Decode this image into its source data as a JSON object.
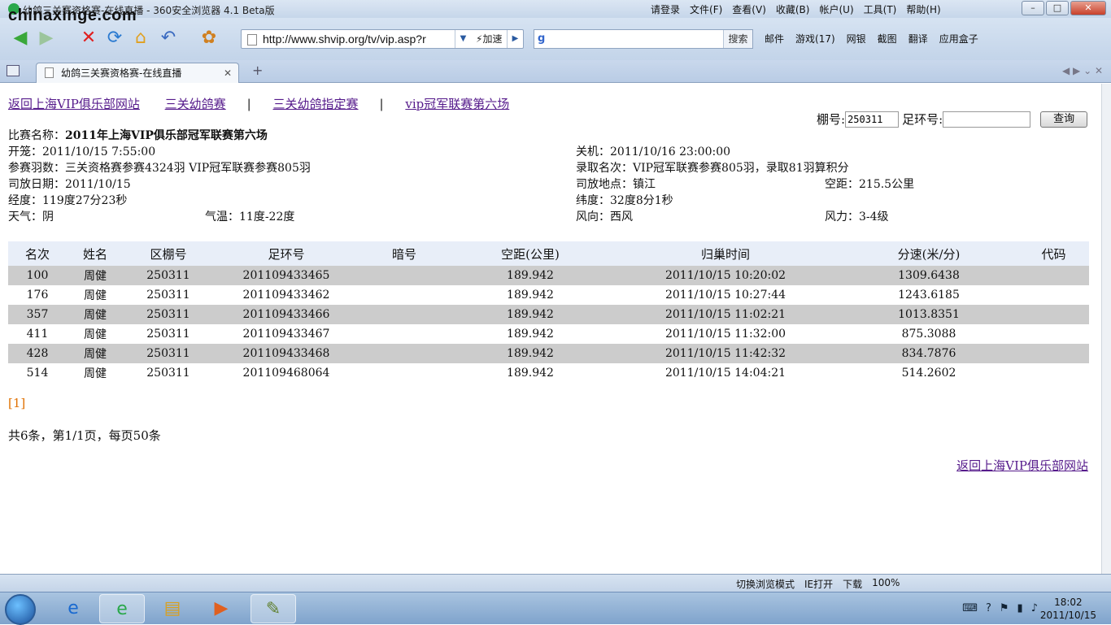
{
  "watermark": "chinaxinge.com",
  "window": {
    "title": "幼鸽三关赛资格赛-在线直播 - 360安全浏览器 4.1 Beta版",
    "menu": [
      "请登录",
      "文件(F)",
      "查看(V)",
      "收藏(B)",
      "帐户(U)",
      "工具(T)",
      "帮助(H)"
    ]
  },
  "toolbar": {
    "url": "http://www.shvip.org/tv/vip.asp?r",
    "speed_label": "加速",
    "search_button": "搜索",
    "tools": [
      "邮件",
      "游戏(17)",
      "网银",
      "截图",
      "翻译",
      "应用盒子"
    ]
  },
  "tab": {
    "title": "幼鸽三关赛资格赛-在线直播"
  },
  "page": {
    "links": [
      "返回上海VIP俱乐部网站",
      "三关幼鸽赛",
      "三关幼鸽指定赛",
      "vip冠军联赛第六场"
    ],
    "sep": "|",
    "query": {
      "shed_label": "棚号:",
      "shed_value": "250311",
      "ring_label": "足环号:",
      "ring_value": "",
      "button": "查询"
    },
    "info": {
      "race_label": "比赛名称：",
      "race_name": "2011年上海VIP俱乐部冠军联赛第六场",
      "open": "开笼：2011/10/15 7:55:00",
      "close": "关机：2011/10/16 23:00:00",
      "entries": "参赛羽数：三关资格赛参赛4324羽 VIP冠军联赛参赛805羽",
      "admitted": "录取名次：VIP冠军联赛参赛805羽，录取81羽算积分",
      "release_date": "司放日期：2011/10/15",
      "release_place": "司放地点：镇江",
      "distance": "空距：215.5公里",
      "longitude": "经度：119度27分23秒",
      "latitude": "纬度：32度8分1秒",
      "weather": "天气：阴",
      "temperature": "气温：11度-22度",
      "wind_dir": "风向：西风",
      "wind_force": "风力：3-4级"
    },
    "table": {
      "headers": [
        "名次",
        "姓名",
        "区棚号",
        "足环号",
        "暗号",
        "空距(公里)",
        "归巢时间",
        "分速(米/分)",
        "代码"
      ],
      "rows": [
        [
          "100",
          "周健",
          "250311",
          "201109433465",
          "",
          "189.942",
          "2011/10/15 10:20:02",
          "1309.6438",
          ""
        ],
        [
          "176",
          "周健",
          "250311",
          "201109433462",
          "",
          "189.942",
          "2011/10/15 10:27:44",
          "1243.6185",
          ""
        ],
        [
          "357",
          "周健",
          "250311",
          "201109433466",
          "",
          "189.942",
          "2011/10/15 11:02:21",
          "1013.8351",
          ""
        ],
        [
          "411",
          "周健",
          "250311",
          "201109433467",
          "",
          "189.942",
          "2011/10/15 11:32:00",
          "875.3088",
          ""
        ],
        [
          "428",
          "周健",
          "250311",
          "201109433468",
          "",
          "189.942",
          "2011/10/15 11:42:32",
          "834.7876",
          ""
        ],
        [
          "514",
          "周健",
          "250311",
          "201109468064",
          "",
          "189.942",
          "2011/10/15 14:04:21",
          "514.2602",
          ""
        ]
      ]
    },
    "pager": "[1]",
    "total": "共6条，第1/1页，每页50条",
    "back_link": "返回上海VIP俱乐部网站"
  },
  "statusbar": {
    "items": [
      "切换浏览模式",
      "IE打开",
      "下载",
      "100%"
    ]
  },
  "taskbar": {
    "time": "18:02",
    "date": "2011/10/15"
  }
}
